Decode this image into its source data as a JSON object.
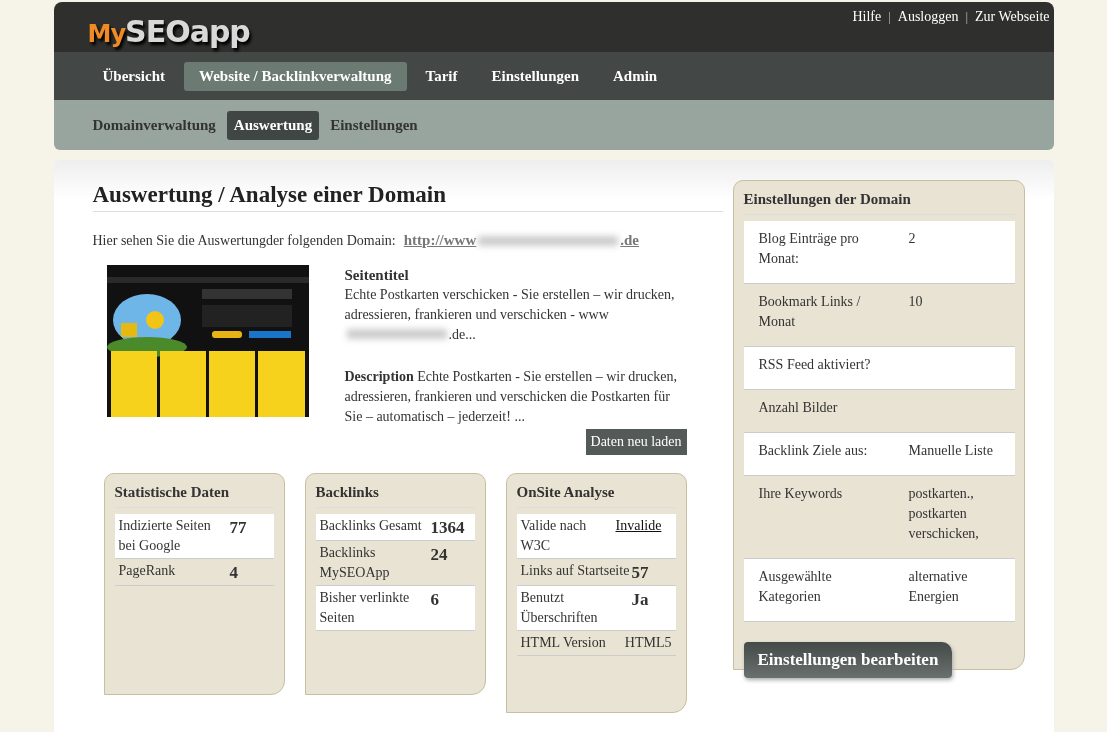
{
  "logo": {
    "prefix": "My",
    "rest": "SEOapp"
  },
  "top_links": [
    {
      "kind": "link",
      "text": "Hilfe"
    },
    {
      "kind": "separator",
      "text": "|"
    },
    {
      "kind": "link",
      "text": "Ausloggen"
    },
    {
      "kind": "separator",
      "text": "|"
    },
    {
      "kind": "link",
      "text": "Zur Webseite"
    }
  ],
  "main_nav": [
    {
      "label": "Übersicht",
      "selected": false
    },
    {
      "label": "Website / Backlinkverwaltung",
      "selected": true
    },
    {
      "label": "Tarif",
      "selected": false
    },
    {
      "label": "Einstellungen",
      "selected": false
    },
    {
      "label": "Admin",
      "selected": false
    }
  ],
  "sub_nav": [
    {
      "label": "Domainverwaltung",
      "selected": false
    },
    {
      "label": "Auswertung",
      "selected": true
    },
    {
      "label": "Einstellungen",
      "selected": false
    }
  ],
  "page_title": "Auswertung / Analyse einer Domain",
  "intro": {
    "text": "Hier sehen Sie die Auswertungder folgenden Domain:",
    "url_start": "http://www",
    "url_end": ".de"
  },
  "seitentitel": {
    "heading": "Seitentitel",
    "text_start": "Echte Postkarten verschicken - Sie erstellen – wir drucken, adressieren, frankieren und verschicken - www",
    "text_end": ".de..."
  },
  "description": {
    "heading": "Description",
    "text": "Echte Postkarten - Sie erstellen – wir drucken, adressieren, frankieren und verschicken die Postkarten für Sie – automatisch – jederzeit! ..."
  },
  "reload_button": "Daten neu laden",
  "boxes": [
    {
      "title": "Statistische Daten",
      "rows": [
        {
          "label": "Indizierte Seiten bei Google",
          "value": "77",
          "kind": "number"
        },
        {
          "label": "PageRank",
          "value": "4",
          "kind": "number"
        }
      ]
    },
    {
      "title": "Backlinks",
      "rows": [
        {
          "label": "Backlinks Gesamt",
          "value": "1364",
          "kind": "number"
        },
        {
          "label": "Backlinks MySEOApp",
          "value": "24",
          "kind": "number"
        },
        {
          "label": "Bisher verlinkte Seiten",
          "value": "6",
          "kind": "number"
        }
      ]
    },
    {
      "title": "OnSite Analyse",
      "rows": [
        {
          "label": "Valide nach W3C",
          "value": "Invalide",
          "kind": "link"
        },
        {
          "label": "Links auf Startseite",
          "value": "57",
          "kind": "number"
        },
        {
          "label": "Benutzt Überschriften",
          "value": "Ja",
          "kind": "number"
        },
        {
          "label": "HTML Version",
          "value": "HTML5",
          "kind": "text"
        }
      ]
    }
  ],
  "settings": {
    "title": "Einstellungen der Domain",
    "rows": [
      {
        "label": "Blog Einträge pro Monat:",
        "value": "2"
      },
      {
        "label": "Bookmark Links / Monat",
        "value": "10"
      },
      {
        "label": "RSS Feed aktiviert?"
      },
      {
        "label": "Anzahl Bilder"
      },
      {
        "label": "Backlink Ziele aus:",
        "value": "Manuelle Liste"
      },
      {
        "label": "Ihre Keywords",
        "value": "postkarten., postkarten verschicken,"
      },
      {
        "label": "Ausgewählte Kategorien",
        "value": "alternative Energien"
      }
    ],
    "button": "Einstellungen bearbeiten"
  }
}
